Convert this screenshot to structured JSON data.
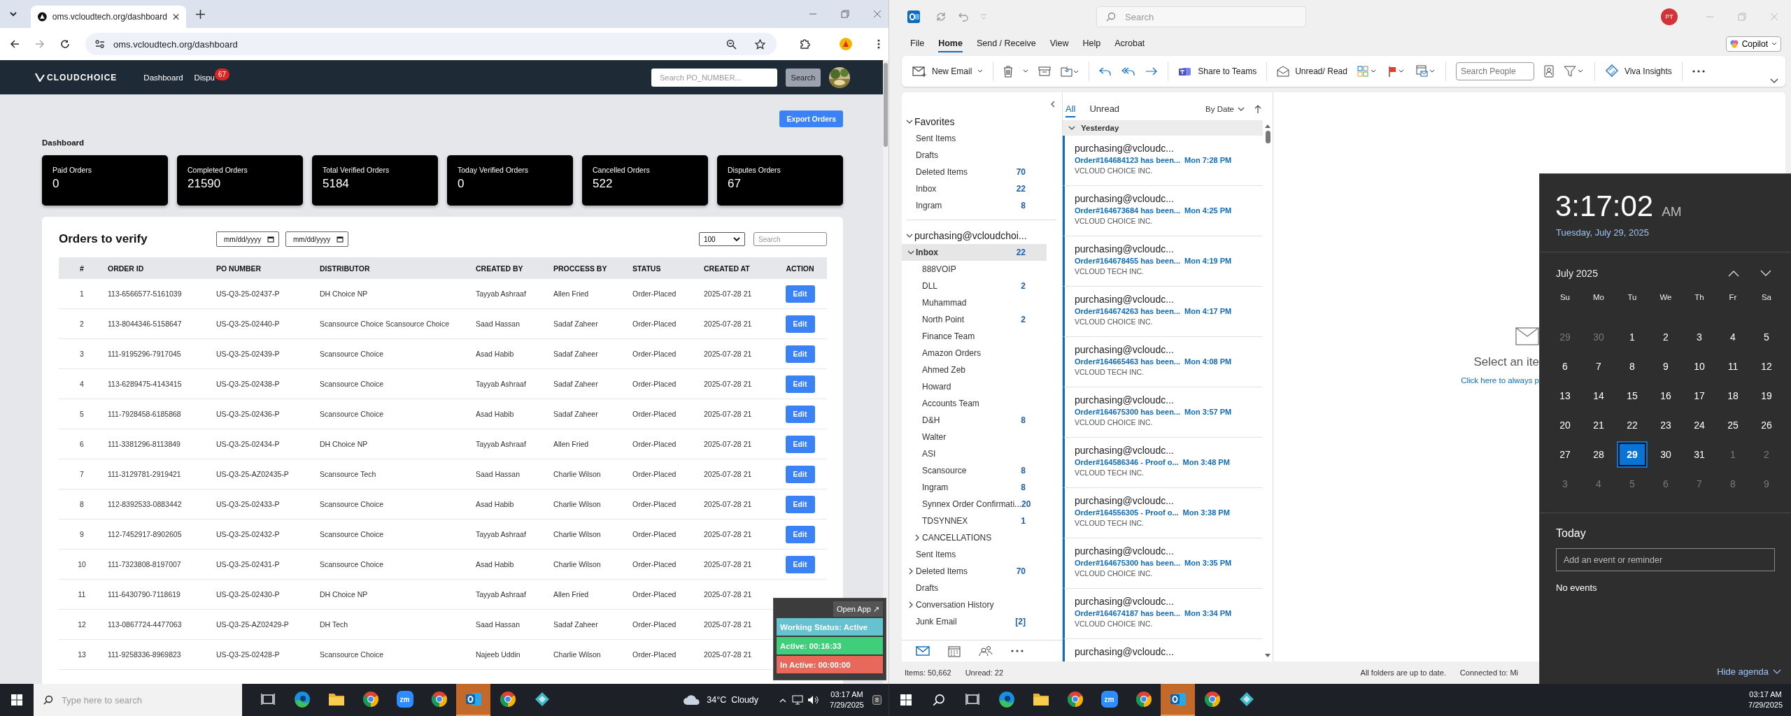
{
  "browser": {
    "tab": {
      "title": "oms.vcloudtech.org/dashboard"
    },
    "address": "oms.vcloudtech.org/dashboard",
    "site_nav": {
      "logo": "CLOUDCHOICE",
      "links": [
        {
          "label": "Dashboard"
        },
        {
          "label": "Dispu",
          "badge": "67"
        }
      ],
      "search": {
        "placeholder": "Search PO_NUMBER..."
      },
      "search_button": "Search"
    },
    "export_button": "Export Orders",
    "heading": "Dashboard",
    "stats": [
      {
        "label": "Paid Orders",
        "value": "0"
      },
      {
        "label": "Completed Orders",
        "value": "21590"
      },
      {
        "label": "Total Verified Orders",
        "value": "5184"
      },
      {
        "label": "Today Verified Orders",
        "value": "0"
      },
      {
        "label": "Cancelled Orders",
        "value": "522"
      },
      {
        "label": "Disputes Orders",
        "value": "67"
      }
    ],
    "orders": {
      "title": "Orders to verify",
      "date_from": {
        "placeholder": "mm/dd/yyyy"
      },
      "date_to": {
        "placeholder": "mm/dd/yyyy"
      },
      "page_size": "100",
      "search": {
        "placeholder": "Search"
      },
      "columns": [
        "#",
        "ORDER ID",
        "PO NUMBER",
        "DISTRIBUTOR",
        "CREATED BY",
        "PROCCESS BY",
        "STATUS",
        "CREATED AT",
        "ACTION"
      ],
      "rows": [
        {
          "cells": [
            "1",
            "113-6566577-5161039",
            "US-Q3-25-02437-P",
            "DH Choice NP",
            "Tayyab Ashraaf",
            "Allen Fried",
            "Order-Placed",
            "2025-07-28 21"
          ],
          "action": "Edit"
        },
        {
          "cells": [
            "2",
            "113-8044346-5158647",
            "US-Q3-25-02440-P",
            "Scansource Choice Scansource Choice",
            "Saad Hassan",
            "Sadaf Zaheer",
            "Order-Placed",
            "2025-07-28 21"
          ],
          "action": "Edit"
        },
        {
          "cells": [
            "3",
            "111-9195296-7917045",
            "US-Q3-25-02439-P",
            "Scansource Choice",
            "Asad Habib",
            "Sadaf Zaheer",
            "Order-Placed",
            "2025-07-28 21"
          ],
          "action": "Edit"
        },
        {
          "cells": [
            "4",
            "113-6289475-4143415",
            "US-Q3-25-02438-P",
            "Scansource Choice",
            "Tayyab Ashraaf",
            "Sadaf Zaheer",
            "Order-Placed",
            "2025-07-28 21"
          ],
          "action": "Edit"
        },
        {
          "cells": [
            "5",
            "111-7928458-6185868",
            "US-Q3-25-02436-P",
            "Scansource Choice",
            "Asad Habib",
            "Sadaf Zaheer",
            "Order-Placed",
            "2025-07-28 21"
          ],
          "action": "Edit"
        },
        {
          "cells": [
            "6",
            "111-3381296-8113849",
            "US-Q3-25-02434-P",
            "DH Choice NP",
            "Tayyab Ashraaf",
            "Allen Fried",
            "Order-Placed",
            "2025-07-28 21"
          ],
          "action": "Edit"
        },
        {
          "cells": [
            "7",
            "111-3129781-2919421",
            "US-Q3-25-AZ02435-P",
            "Scansource Tech",
            "Saad Hassan",
            "Charlie Wilson",
            "Order-Placed",
            "2025-07-28 21"
          ],
          "action": "Edit"
        },
        {
          "cells": [
            "8",
            "112-8392533-0883442",
            "US-Q3-25-02433-P",
            "Scansource Choice",
            "Asad Habib",
            "Charlie Wilson",
            "Order-Placed",
            "2025-07-28 21"
          ],
          "action": "Edit"
        },
        {
          "cells": [
            "9",
            "112-7452917-8902605",
            "US-Q3-25-02432-P",
            "Scansource Choice",
            "Tayyab Ashraaf",
            "Charlie Wilson",
            "Order-Placed",
            "2025-07-28 21"
          ],
          "action": "Edit"
        },
        {
          "cells": [
            "10",
            "111-7323808-8197007",
            "US-Q3-25-02431-P",
            "Scansource Choice",
            "Asad Habib",
            "Charlie Wilson",
            "Order-Placed",
            "2025-07-28 21"
          ],
          "action": "Edit"
        },
        {
          "cells": [
            "11",
            "111-6430790-7118619",
            "US-Q3-25-02430-P",
            "DH Choice NP",
            "Tayyab Ashraaf",
            "Allen Fried",
            "Order-Placed",
            "2025-07-28 21"
          ]
        },
        {
          "cells": [
            "12",
            "113-0867724-4477063",
            "US-Q3-25-AZ02429-P",
            "DH Tech",
            "Saad Hassan",
            "Sadaf Zaheer",
            "Order-Placed",
            "2025-07-28 21"
          ]
        },
        {
          "cells": [
            "13",
            "111-9258336-8969823",
            "US-Q3-25-02428-P",
            "Scansource Choice",
            "Najeeb Uddin",
            "Charlie Wilson",
            "Order-Placed",
            "2025-07-28 21"
          ]
        }
      ]
    }
  },
  "tracker": {
    "open_app": "Open App ↗",
    "status": "Working Status: Active",
    "active": "Active: 00:16:33",
    "inactive": "In Active: 00:00:00"
  },
  "outlook": {
    "search": {
      "placeholder": "Search"
    },
    "avatar": "PT",
    "copilot": "Copilot",
    "menu": [
      {
        "label": "File",
        "selected": false
      },
      {
        "label": "Home",
        "selected": true
      },
      {
        "label": "Send / Receive",
        "selected": false
      },
      {
        "label": "View",
        "selected": false
      },
      {
        "label": "Help",
        "selected": false
      },
      {
        "label": "Acrobat",
        "selected": false
      }
    ],
    "ribbon": {
      "new_email": "New Email",
      "share": "Share to Teams",
      "unread_read": "Unread/ Read",
      "search_people": {
        "placeholder": "Search People"
      },
      "viva": "Viva Insights"
    },
    "favorites": {
      "title": "Favorites",
      "expanded": true,
      "items": [
        {
          "name": "Sent Items",
          "selected": false
        },
        {
          "name": "Drafts",
          "selected": false
        },
        {
          "name": "Deleted Items",
          "count": "70",
          "selected": false
        },
        {
          "name": "Inbox",
          "count": "22",
          "selected": false
        },
        {
          "name": "Ingram",
          "count": "8",
          "selected": false
        }
      ]
    },
    "account": {
      "name": "purchasing@vcloudchoi...",
      "expanded": true,
      "folders": [
        {
          "name": "Inbox",
          "count": "22",
          "selected": true,
          "expanded": true,
          "children": [
            {
              "name": "888VOIP",
              "selected": false
            },
            {
              "name": "DLL",
              "count": "2",
              "selected": false
            },
            {
              "name": "Muhammad",
              "selected": false
            },
            {
              "name": "North Point",
              "count": "2",
              "selected": false
            },
            {
              "name": "Finance Team",
              "selected": false
            },
            {
              "name": "Amazon Orders",
              "selected": false
            },
            {
              "name": "Ahmed Zeb",
              "selected": false
            },
            {
              "name": "Howard",
              "selected": false
            },
            {
              "name": "Accounts Team",
              "selected": false
            },
            {
              "name": "D&H",
              "count": "8",
              "selected": false
            },
            {
              "name": "Walter",
              "selected": false
            },
            {
              "name": "ASI",
              "selected": false
            },
            {
              "name": "Scansource",
              "count": "8",
              "selected": false
            },
            {
              "name": "Ingram",
              "count": "8",
              "selected": false
            },
            {
              "name": "Synnex Order Confirmati...",
              "count": "20",
              "selected": false
            },
            {
              "name": "TDSYNNEX",
              "count": "1",
              "selected": false
            },
            {
              "name": "CANCELLATIONS",
              "selected": false,
              "expanded": false
            }
          ]
        },
        {
          "name": "Sent Items",
          "selected": false
        },
        {
          "name": "Deleted Items",
          "count": "70",
          "selected": false,
          "expanded": false
        },
        {
          "name": "Drafts",
          "selected": false
        },
        {
          "name": "Conversation History",
          "selected": false,
          "expanded": false
        },
        {
          "name": "Junk Email",
          "count": "[2]",
          "selected": false
        }
      ]
    },
    "mail_list": {
      "filters": [
        {
          "label": "All",
          "selected": true
        },
        {
          "label": "Unread",
          "selected": false
        }
      ],
      "sort": "By Date",
      "group": {
        "label": "Yesterday",
        "expanded": true
      },
      "messages": [
        {
          "sender": "purchasing@vcloudc...",
          "subject": "Order#164684123 has been...",
          "time": "Mon 7:28 PM",
          "company": "VCLOUD CHOICE INC.",
          "unread": true
        },
        {
          "sender": "purchasing@vcloudc...",
          "subject": "Order#164673684 has been...",
          "time": "Mon 4:25 PM",
          "company": "VCLOUD CHOICE INC.",
          "unread": true
        },
        {
          "sender": "purchasing@vcloudc...",
          "subject": "Order#164678455 has been...",
          "time": "Mon 4:19 PM",
          "company": "VCLOUD TECH INC.",
          "unread": true
        },
        {
          "sender": "purchasing@vcloudc...",
          "subject": "Order#164674263 has been...",
          "time": "Mon 4:17 PM",
          "company": "VCLOUD CHOICE INC.",
          "unread": true
        },
        {
          "sender": "purchasing@vcloudc...",
          "subject": "Order#164665463 has been...",
          "time": "Mon 4:08 PM",
          "company": "VCLOUD TECH INC.",
          "unread": true
        },
        {
          "sender": "purchasing@vcloudc...",
          "subject": "Order#164675300 has been...",
          "time": "Mon 3:57 PM",
          "company": "VCLOUD CHOICE INC.",
          "unread": true
        },
        {
          "sender": "purchasing@vcloudc...",
          "subject": "Order#164586346 - Proof o...",
          "time": "Mon 3:48 PM",
          "company": "VCLOUD TECH INC.",
          "unread": true
        },
        {
          "sender": "purchasing@vcloudc...",
          "subject": "Order#164556305 - Proof o...",
          "time": "Mon 3:38 PM",
          "company": "VCLOUD TECH INC.",
          "unread": true
        },
        {
          "sender": "purchasing@vcloudc...",
          "subject": "Order#164675300 has been...",
          "time": "Mon 3:35 PM",
          "company": "VCLOUD CHOICE INC.",
          "unread": true
        },
        {
          "sender": "purchasing@vcloudc...",
          "subject": "Order#164674187 has been...",
          "time": "Mon 3:34 PM",
          "company": "VCLOUD CHOICE INC.",
          "unread": true
        },
        {
          "sender": "purchasing@vcloudc...",
          "unread": true
        }
      ]
    },
    "reading_pane": {
      "title": "Select an ite",
      "link": "Click here to always p"
    },
    "status_bar": {
      "items": "Items: 50,662",
      "unread": "Unread: 22",
      "sync": "All folders are up to date.",
      "connection": "Connected to: Mi"
    }
  },
  "clock_flyout": {
    "time": "3:17:02",
    "ampm": "AM",
    "date": "Tuesday, July 29, 2025",
    "month": "July 2025",
    "weekdays": [
      "Su",
      "Mo",
      "Tu",
      "We",
      "Th",
      "Fr",
      "Sa"
    ],
    "weeks": [
      {
        "days": [
          {
            "day": "29",
            "other_month": true,
            "selected": false
          },
          {
            "day": "30",
            "other_month": true,
            "selected": false
          },
          {
            "day": "1",
            "other_month": false,
            "selected": false
          },
          {
            "day": "2",
            "other_month": false,
            "selected": false
          },
          {
            "day": "3",
            "other_month": false,
            "selected": false
          },
          {
            "day": "4",
            "other_month": false,
            "selected": false
          },
          {
            "day": "5",
            "other_month": false,
            "selected": false
          }
        ]
      },
      {
        "days": [
          {
            "day": "6",
            "other_month": false,
            "selected": false
          },
          {
            "day": "7",
            "other_month": false,
            "selected": false
          },
          {
            "day": "8",
            "other_month": false,
            "selected": false
          },
          {
            "day": "9",
            "other_month": false,
            "selected": false
          },
          {
            "day": "10",
            "other_month": false,
            "selected": false
          },
          {
            "day": "11",
            "other_month": false,
            "selected": false
          },
          {
            "day": "12",
            "other_month": false,
            "selected": false
          }
        ]
      },
      {
        "days": [
          {
            "day": "13",
            "other_month": false,
            "selected": false
          },
          {
            "day": "14",
            "other_month": false,
            "selected": false
          },
          {
            "day": "15",
            "other_month": false,
            "selected": false
          },
          {
            "day": "16",
            "other_month": false,
            "selected": false
          },
          {
            "day": "17",
            "other_month": false,
            "selected": false
          },
          {
            "day": "18",
            "other_month": false,
            "selected": false
          },
          {
            "day": "19",
            "other_month": false,
            "selected": false
          }
        ]
      },
      {
        "days": [
          {
            "day": "20",
            "other_month": false,
            "selected": false
          },
          {
            "day": "21",
            "other_month": false,
            "selected": false
          },
          {
            "day": "22",
            "other_month": false,
            "selected": false
          },
          {
            "day": "23",
            "other_month": false,
            "selected": false
          },
          {
            "day": "24",
            "other_month": false,
            "selected": false
          },
          {
            "day": "25",
            "other_month": false,
            "selected": false
          },
          {
            "day": "26",
            "other_month": false,
            "selected": false
          }
        ]
      },
      {
        "days": [
          {
            "day": "27",
            "other_month": false,
            "selected": false
          },
          {
            "day": "28",
            "other_month": false,
            "selected": false
          },
          {
            "day": "29",
            "other_month": false,
            "selected": true
          },
          {
            "day": "30",
            "other_month": false,
            "selected": false
          },
          {
            "day": "31",
            "other_month": false,
            "selected": false
          },
          {
            "day": "1",
            "other_month": true,
            "selected": false
          },
          {
            "day": "2",
            "other_month": true,
            "selected": false
          }
        ]
      },
      {
        "days": [
          {
            "day": "3",
            "other_month": true,
            "selected": false
          },
          {
            "day": "4",
            "other_month": true,
            "selected": false
          },
          {
            "day": "5",
            "other_month": true,
            "selected": false
          },
          {
            "day": "6",
            "other_month": true,
            "selected": false
          },
          {
            "day": "7",
            "other_month": true,
            "selected": false
          },
          {
            "day": "8",
            "other_month": true,
            "selected": false
          },
          {
            "day": "9",
            "other_month": true,
            "selected": false
          }
        ]
      }
    ],
    "agenda_title": "Today",
    "event_field": {
      "placeholder": "Add an event or reminder"
    },
    "no_events": "No events",
    "hide_agenda": "Hide agenda"
  },
  "taskbars": [
    {
      "search": {
        "placeholder": "Type here to search"
      },
      "apps": [
        {
          "kind": "task-view",
          "active": false
        },
        {
          "kind": "edge",
          "active": false
        },
        {
          "kind": "folder",
          "active": false
        },
        {
          "kind": "chrome",
          "active": false
        },
        {
          "kind": "zoom",
          "label": "zm",
          "active": false
        },
        {
          "kind": "chrome",
          "active": false
        },
        {
          "kind": "outlook",
          "active": true
        },
        {
          "kind": "chrome",
          "active": false
        },
        {
          "kind": "app",
          "active": false
        }
      ],
      "weather": "34°C  Cloudy",
      "time": "03:17 AM",
      "date": "7/29/2025",
      "notifications": "8"
    },
    {
      "apps": [
        {
          "kind": "task-view",
          "active": false
        },
        {
          "kind": "edge",
          "active": false
        },
        {
          "kind": "folder",
          "active": false
        },
        {
          "kind": "chrome",
          "active": false
        },
        {
          "kind": "zoom",
          "label": "zm",
          "active": false
        },
        {
          "kind": "chrome",
          "active": false
        },
        {
          "kind": "outlook",
          "active": true
        },
        {
          "kind": "chrome",
          "active": false
        },
        {
          "kind": "app",
          "active": false
        }
      ],
      "time": "03:17 AM",
      "date": "7/29/2025"
    }
  ]
}
